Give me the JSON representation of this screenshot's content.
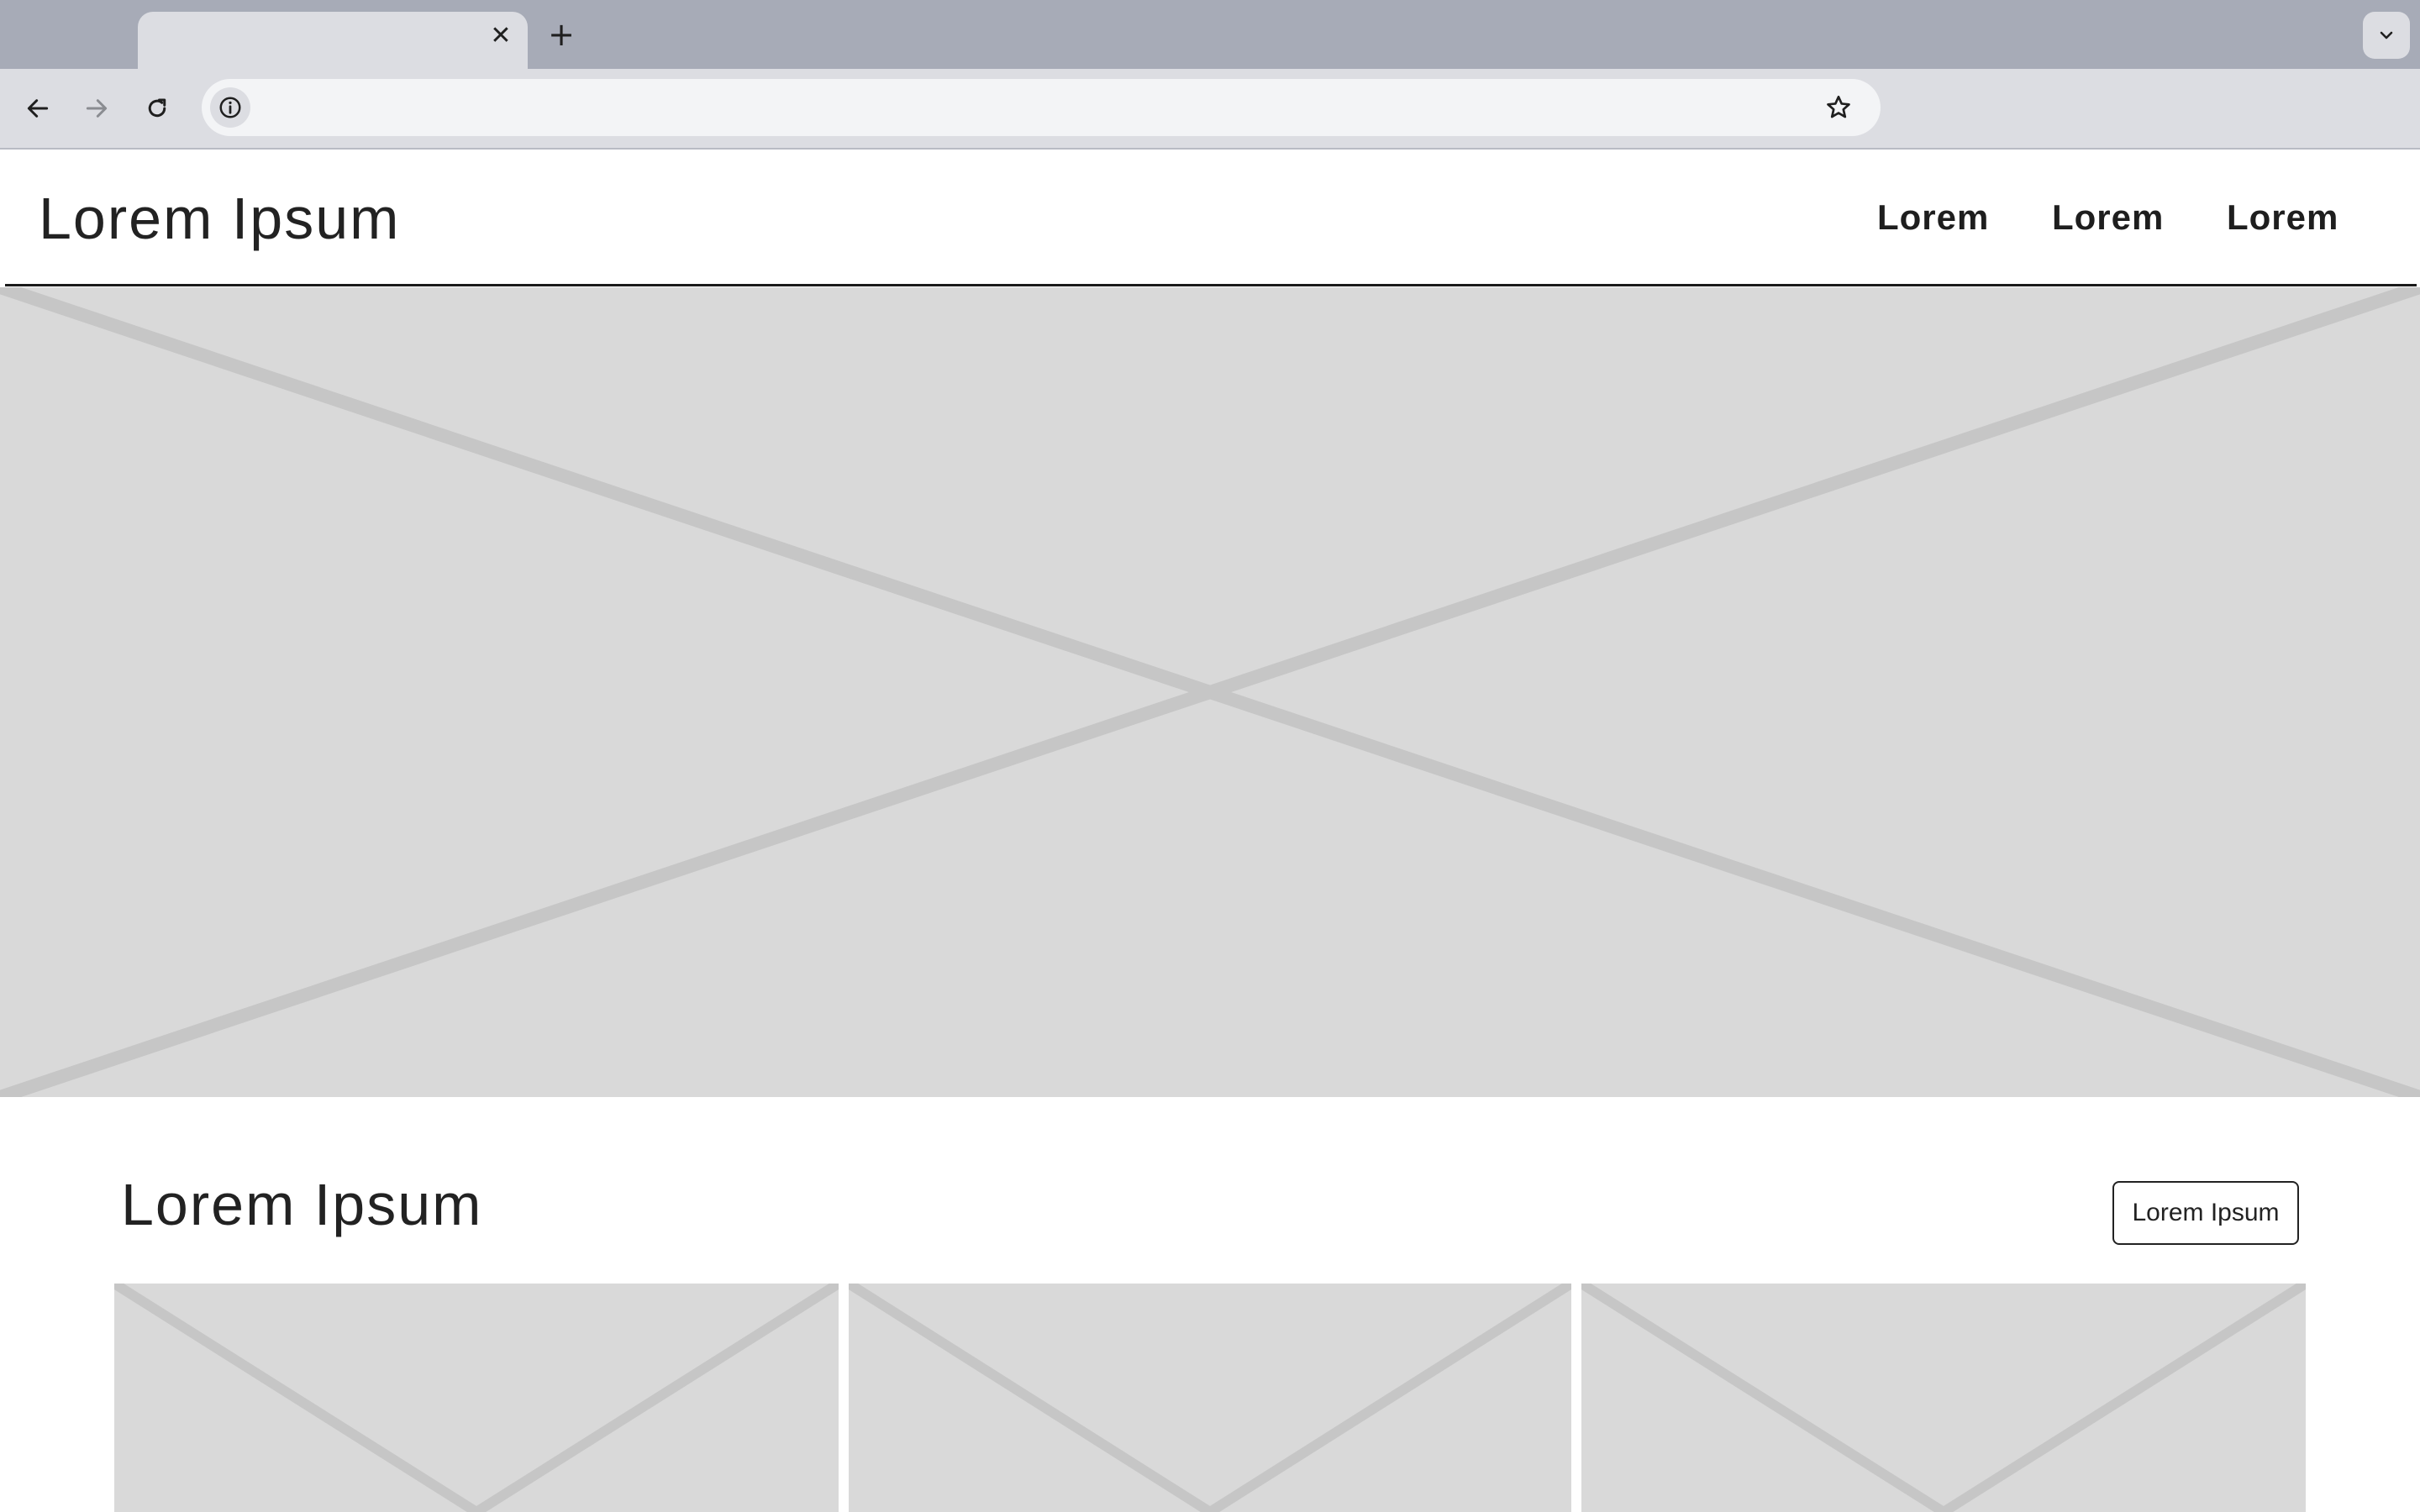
{
  "browser": {
    "tab_close_glyph": "✕",
    "new_tab_glyph": "+",
    "address_value": "",
    "icons": [
      "close-icon",
      "plus-icon",
      "chevron-down-icon",
      "back-arrow-icon",
      "forward-arrow-icon",
      "reload-icon",
      "info-icon",
      "star-icon"
    ]
  },
  "header": {
    "title": "Lorem Ipsum",
    "nav": [
      {
        "label": "Lorem"
      },
      {
        "label": "Lorem"
      },
      {
        "label": "Lorem"
      }
    ]
  },
  "section": {
    "title": "Lorem Ipsum",
    "button_label": "Lorem Ipsum"
  },
  "colors": {
    "tabstrip": "#a7abb7",
    "toolbar": "#dcdde2",
    "placeholder_fill": "#d9d9d9",
    "placeholder_cross": "#c6c6c6",
    "text": "#222222"
  }
}
